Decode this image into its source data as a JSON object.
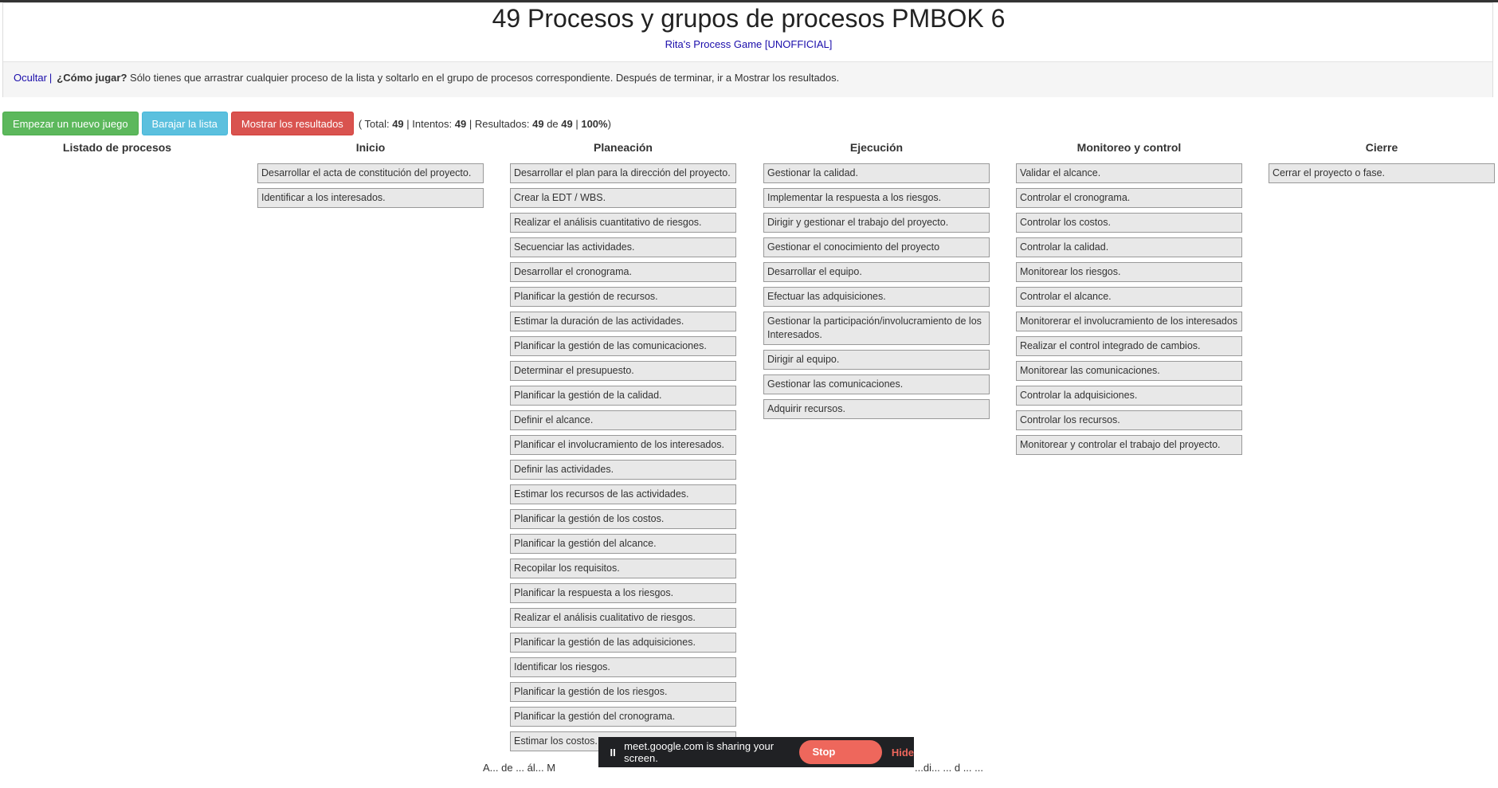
{
  "header": {
    "title": "49 Procesos y grupos de procesos PMBOK 6",
    "subtitle": "Rita's Process Game [UNOFFICIAL]"
  },
  "instructions": {
    "hide_label": "Ocultar",
    "separator": "|",
    "question": "¿Cómo jugar?",
    "text": " Sólo tienes que arrastrar cualquier proceso de la lista y soltarlo en el grupo de procesos correspondiente. Después de terminar, ir a Mostrar los resultados."
  },
  "controls": {
    "new_game": "Empezar un nuevo juego",
    "shuffle": "Barajar la lista",
    "show_results": "Mostrar los resultados",
    "stats": {
      "open": "( Total: ",
      "total": "49",
      "sep1": " | Intentos: ",
      "attempts": "49",
      "sep2": " | Resultados: ",
      "results": "49",
      "of": " de ",
      "results_total": "49",
      "sep3": " | ",
      "percent": "100%",
      "close": ")"
    }
  },
  "columns": {
    "listado": {
      "title": "Listado de procesos",
      "items": []
    },
    "inicio": {
      "title": "Inicio",
      "items": [
        "Desarrollar el acta de constitución del proyecto.",
        "Identificar a los interesados."
      ]
    },
    "planeacion": {
      "title": "Planeación",
      "items": [
        "Desarrollar el plan para la dirección del proyecto.",
        "Crear la EDT / WBS.",
        "Realizar el análisis cuantitativo de riesgos.",
        "Secuenciar las actividades.",
        "Desarrollar el cronograma.",
        "Planificar la gestión de recursos.",
        "Estimar la duración de las actividades.",
        "Planificar la gestión de las comunicaciones.",
        "Determinar el presupuesto.",
        "Planificar la gestión de la calidad.",
        "Definir el alcance.",
        "Planificar el involucramiento de los interesados.",
        "Definir las actividades.",
        "Estimar los recursos de las actividades.",
        "Planificar la gestión de los costos.",
        "Planificar la gestión del alcance.",
        "Recopilar los requisitos.",
        "Planificar la respuesta a los riesgos.",
        "Realizar el análisis cualitativo de riesgos.",
        "Planificar la gestión de las adquisiciones.",
        "Identificar los riesgos.",
        "Planificar la gestión de los riesgos.",
        "Planificar la gestión del cronograma.",
        "Estimar los costos."
      ]
    },
    "ejecucion": {
      "title": "Ejecución",
      "items": [
        "Gestionar la calidad.",
        "Implementar la respuesta a los riesgos.",
        "Dirigir y gestionar el trabajo del proyecto.",
        "Gestionar el conocimiento del proyecto",
        "Desarrollar el equipo.",
        "Efectuar las adquisiciones.",
        "Gestionar la participación/involucramiento de los Interesados.",
        "Dirigir al equipo.",
        "Gestionar las comunicaciones.",
        "Adquirir recursos."
      ]
    },
    "monitoreo": {
      "title": "Monitoreo y control",
      "items": [
        "Validar el alcance.",
        "Controlar el cronograma.",
        "Controlar los costos.",
        "Controlar la calidad.",
        "Monitorear los riesgos.",
        "Controlar el alcance.",
        "Monitorerar el involucramiento de los interesados",
        "Realizar el control integrado de cambios.",
        "Monitorear las comunicaciones.",
        "Controlar la adquisiciones.",
        "Controlar los recursos.",
        "Monitorear y controlar el trabajo del proyecto."
      ]
    },
    "cierre": {
      "title": "Cierre",
      "items": [
        "Cerrar el proyecto o fase."
      ]
    }
  },
  "share_bar": {
    "pause_icon": "II",
    "text": "meet.google.com is sharing your screen.",
    "stop": "Stop sharing",
    "hide": "Hide"
  },
  "footer": {
    "left": "A... de ... ál... M",
    "right": "...di... ... d ... ..."
  }
}
